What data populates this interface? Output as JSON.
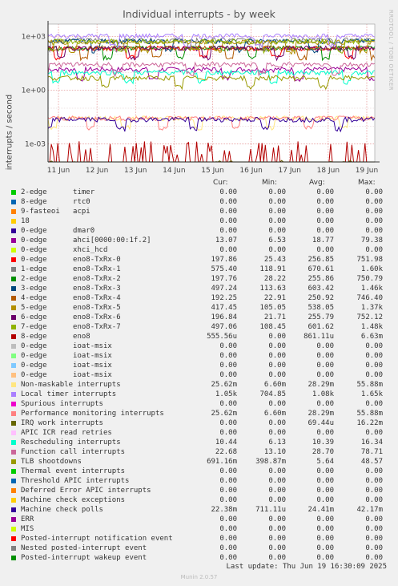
{
  "title": "Individual interrupts - by week",
  "ylabel": "interrupts / second",
  "watermark": "RRDTOOL / TOBI OETIKER",
  "columns": {
    "cur": "Cur:",
    "min": "Min:",
    "avg": "Avg:",
    "max": "Max:"
  },
  "last_update": "Last update: Thu Jun 19 16:30:09 2025",
  "munin": "Munin 2.0.57",
  "chart_data": {
    "type": "line",
    "y_scale": "log",
    "ylim": [
      0.0001,
      5000
    ],
    "y_ticks": [
      {
        "v": 1000,
        "label": "1e+03"
      },
      {
        "v": 1,
        "label": "1e+00"
      },
      {
        "v": 0.001,
        "label": "1e-03"
      }
    ],
    "x_ticks": [
      "11 Jun",
      "12 Jun",
      "13 Jun",
      "14 Jun",
      "15 Jun",
      "16 Jun",
      "17 Jun",
      "18 Jun",
      "19 Jun"
    ],
    "grid": true,
    "series": [
      {
        "name": "2-edge timer",
        "color": "#00cc00",
        "level": 0
      },
      {
        "name": "8-edge rtc0",
        "color": "#0066b3",
        "level": 0
      },
      {
        "name": "9-fasteoi acpi",
        "color": "#ff8000",
        "level": 0
      },
      {
        "name": "18",
        "color": "#ffcc00",
        "level": 0
      },
      {
        "name": "0-edge dmar0",
        "color": "#330099",
        "level": 0
      },
      {
        "name": "0-edge ahci[0000:00:1f.2]",
        "color": "#990099",
        "level": 15
      },
      {
        "name": "0-edge xhci_hcd",
        "color": "#ccff00",
        "level": 0
      },
      {
        "name": "0-edge eno8-TxRx-0",
        "color": "#ff0000",
        "level": 230
      },
      {
        "name": "1-edge eno8-TxRx-1",
        "color": "#808080",
        "level": 650
      },
      {
        "name": "2-edge eno8-TxRx-2",
        "color": "#008f00",
        "level": 230
      },
      {
        "name": "3-edge eno8-TxRx-3",
        "color": "#00487d",
        "level": 560
      },
      {
        "name": "4-edge eno8-TxRx-4",
        "color": "#b35a00",
        "level": 230
      },
      {
        "name": "5-edge eno8-TxRx-5",
        "color": "#b38f00",
        "level": 500
      },
      {
        "name": "6-edge eno8-TxRx-6",
        "color": "#6b006b",
        "level": 230
      },
      {
        "name": "7-edge eno8-TxRx-7",
        "color": "#8fb300",
        "level": 560
      },
      {
        "name": "8-edge eno8",
        "color": "#b30000",
        "level": 0.0008,
        "spiky": true
      },
      {
        "name": "0-edge ioat-msix",
        "color": "#bebebe",
        "level": 0
      },
      {
        "name": "0-edge ioat-msix",
        "color": "#80ff80",
        "level": 0
      },
      {
        "name": "0-edge ioat-msix",
        "color": "#80c9ff",
        "level": 0
      },
      {
        "name": "0-edge ioat-msix",
        "color": "#ffc080",
        "level": 0
      },
      {
        "name": "Non-maskable interrupts",
        "color": "#ffe680",
        "level": 0.028
      },
      {
        "name": "Local timer interrupts",
        "color": "#aa80ff",
        "level": 1100
      },
      {
        "name": "Spurious interrupts",
        "color": "#ee00cc",
        "level": 0
      },
      {
        "name": "Performance monitoring interrupts",
        "color": "#ff8080",
        "level": 0.028
      },
      {
        "name": "IRQ work interrupts",
        "color": "#666600",
        "level": 7e-05,
        "spiky": true
      },
      {
        "name": "APIC ICR read retries",
        "color": "#ffbfff",
        "level": 0
      },
      {
        "name": "Rescheduling interrupts",
        "color": "#00ffcc",
        "level": 10
      },
      {
        "name": "Function call interrupts",
        "color": "#cc6699",
        "level": 28
      },
      {
        "name": "TLB shootdowns",
        "color": "#999900",
        "level": 5
      },
      {
        "name": "Thermal event interrupts",
        "color": "#00cc00",
        "level": 0
      },
      {
        "name": "Threshold APIC interrupts",
        "color": "#0066b3",
        "level": 0
      },
      {
        "name": "Deferred Error APIC interrupts",
        "color": "#ff8000",
        "level": 0
      },
      {
        "name": "Machine check exceptions",
        "color": "#ffcc00",
        "level": 0
      },
      {
        "name": "Machine check polls",
        "color": "#330099",
        "level": 0.024
      },
      {
        "name": "ERR",
        "color": "#990099",
        "level": 0
      },
      {
        "name": "MIS",
        "color": "#ccff00",
        "level": 0
      },
      {
        "name": "Posted-interrupt notification event",
        "color": "#ff0000",
        "level": 0
      },
      {
        "name": "Nested posted-interrupt event",
        "color": "#808080",
        "level": 0
      },
      {
        "name": "Posted-interrupt wakeup event",
        "color": "#008f00",
        "level": 0
      }
    ]
  },
  "legend": [
    {
      "label": "2-edge      timer",
      "cur": "0.00",
      "min": "0.00",
      "avg": "0.00",
      "max": "0.00"
    },
    {
      "label": "8-edge      rtc0",
      "cur": "0.00",
      "min": "0.00",
      "avg": "0.00",
      "max": "0.00"
    },
    {
      "label": "9-fasteoi   acpi",
      "cur": "0.00",
      "min": "0.00",
      "avg": "0.00",
      "max": "0.00"
    },
    {
      "label": "18",
      "cur": "0.00",
      "min": "0.00",
      "avg": "0.00",
      "max": "0.00"
    },
    {
      "label": "0-edge      dmar0",
      "cur": "0.00",
      "min": "0.00",
      "avg": "0.00",
      "max": "0.00"
    },
    {
      "label": "0-edge      ahci[0000:00:1f.2]",
      "cur": "13.07",
      "min": "6.53",
      "avg": "18.77",
      "max": "79.38"
    },
    {
      "label": "0-edge      xhci_hcd",
      "cur": "0.00",
      "min": "0.00",
      "avg": "0.00",
      "max": "0.00"
    },
    {
      "label": "0-edge      eno8-TxRx-0",
      "cur": "197.86",
      "min": "25.43",
      "avg": "256.85",
      "max": "751.98"
    },
    {
      "label": "1-edge      eno8-TxRx-1",
      "cur": "575.40",
      "min": "118.91",
      "avg": "670.61",
      "max": "1.60k"
    },
    {
      "label": "2-edge      eno8-TxRx-2",
      "cur": "197.76",
      "min": "28.22",
      "avg": "255.86",
      "max": "750.79"
    },
    {
      "label": "3-edge      eno8-TxRx-3",
      "cur": "497.24",
      "min": "113.63",
      "avg": "603.42",
      "max": "1.46k"
    },
    {
      "label": "4-edge      eno8-TxRx-4",
      "cur": "192.25",
      "min": "22.91",
      "avg": "250.92",
      "max": "746.40"
    },
    {
      "label": "5-edge      eno8-TxRx-5",
      "cur": "417.45",
      "min": "105.05",
      "avg": "538.05",
      "max": "1.37k"
    },
    {
      "label": "6-edge      eno8-TxRx-6",
      "cur": "196.84",
      "min": "21.71",
      "avg": "255.79",
      "max": "752.12"
    },
    {
      "label": "7-edge      eno8-TxRx-7",
      "cur": "497.06",
      "min": "108.45",
      "avg": "601.62",
      "max": "1.48k"
    },
    {
      "label": "8-edge      eno8",
      "cur": "555.56u",
      "min": "0.00",
      "avg": "861.11u",
      "max": "6.63m"
    },
    {
      "label": "0-edge      ioat-msix",
      "cur": "0.00",
      "min": "0.00",
      "avg": "0.00",
      "max": "0.00"
    },
    {
      "label": "0-edge      ioat-msix",
      "cur": "0.00",
      "min": "0.00",
      "avg": "0.00",
      "max": "0.00"
    },
    {
      "label": "0-edge      ioat-msix",
      "cur": "0.00",
      "min": "0.00",
      "avg": "0.00",
      "max": "0.00"
    },
    {
      "label": "0-edge      ioat-msix",
      "cur": "0.00",
      "min": "0.00",
      "avg": "0.00",
      "max": "0.00"
    },
    {
      "label": "Non-maskable interrupts",
      "cur": "25.62m",
      "min": "6.60m",
      "avg": "28.29m",
      "max": "55.88m"
    },
    {
      "label": "Local timer interrupts",
      "cur": "1.05k",
      "min": "704.85",
      "avg": "1.08k",
      "max": "1.65k"
    },
    {
      "label": "Spurious interrupts",
      "cur": "0.00",
      "min": "0.00",
      "avg": "0.00",
      "max": "0.00"
    },
    {
      "label": "Performance monitoring interrupts",
      "cur": "25.62m",
      "min": "6.60m",
      "avg": "28.29m",
      "max": "55.88m"
    },
    {
      "label": "IRQ work interrupts",
      "cur": "0.00",
      "min": "0.00",
      "avg": "69.44u",
      "max": "16.22m"
    },
    {
      "label": "APIC ICR read retries",
      "cur": "0.00",
      "min": "0.00",
      "avg": "0.00",
      "max": "0.00"
    },
    {
      "label": "Rescheduling interrupts",
      "cur": "10.44",
      "min": "6.13",
      "avg": "10.39",
      "max": "16.34"
    },
    {
      "label": "Function call interrupts",
      "cur": "22.68",
      "min": "13.10",
      "avg": "28.70",
      "max": "78.71"
    },
    {
      "label": "TLB shootdowns",
      "cur": "691.16m",
      "min": "398.87m",
      "avg": "5.64",
      "max": "48.57"
    },
    {
      "label": "Thermal event interrupts",
      "cur": "0.00",
      "min": "0.00",
      "avg": "0.00",
      "max": "0.00"
    },
    {
      "label": "Threshold APIC interrupts",
      "cur": "0.00",
      "min": "0.00",
      "avg": "0.00",
      "max": "0.00"
    },
    {
      "label": "Deferred Error APIC interrupts",
      "cur": "0.00",
      "min": "0.00",
      "avg": "0.00",
      "max": "0.00"
    },
    {
      "label": "Machine check exceptions",
      "cur": "0.00",
      "min": "0.00",
      "avg": "0.00",
      "max": "0.00"
    },
    {
      "label": "Machine check polls",
      "cur": "22.38m",
      "min": "711.11u",
      "avg": "24.41m",
      "max": "42.17m"
    },
    {
      "label": "ERR",
      "cur": "0.00",
      "min": "0.00",
      "avg": "0.00",
      "max": "0.00"
    },
    {
      "label": "MIS",
      "cur": "0.00",
      "min": "0.00",
      "avg": "0.00",
      "max": "0.00"
    },
    {
      "label": "Posted-interrupt notification event",
      "cur": "0.00",
      "min": "0.00",
      "avg": "0.00",
      "max": "0.00"
    },
    {
      "label": "Nested posted-interrupt event",
      "cur": "0.00",
      "min": "0.00",
      "avg": "0.00",
      "max": "0.00"
    },
    {
      "label": "Posted-interrupt wakeup event",
      "cur": "0.00",
      "min": "0.00",
      "avg": "0.00",
      "max": "0.00"
    }
  ]
}
